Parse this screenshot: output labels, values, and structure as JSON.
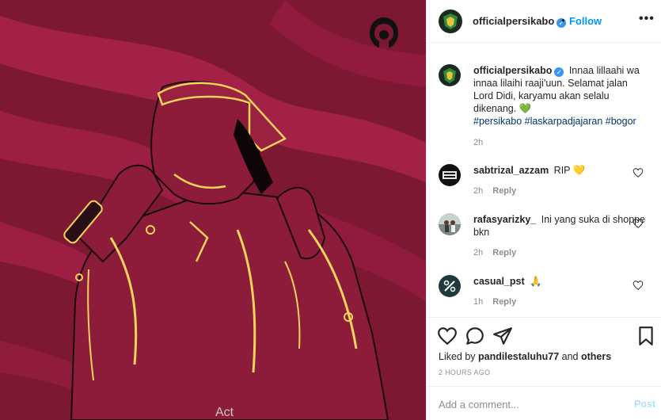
{
  "post": {
    "author": "officialpersikabo",
    "follow_label": "Follow",
    "dot": "•",
    "more_label": "•••"
  },
  "comments": [
    {
      "user": "officialpersikabo",
      "text": "Innaa lillaahi wa innaa lilaihi raaji'uun. Selamat jalan Lord Didi, karyamu akan selalu dikenang. 💚",
      "tags": "#persikabo #laskarpadjajaran #bogor",
      "time": "2h"
    },
    {
      "user": "sabtrizal_azzam",
      "text": "RIP 💛",
      "time": "2h",
      "reply": "Reply"
    },
    {
      "user": "rafasyarizky_",
      "text": "Ini yang suka di shoppe bkn",
      "time": "2h",
      "reply": "Reply"
    },
    {
      "user": "casual_pst",
      "text": "🙏",
      "time": "1h",
      "reply": "Reply"
    }
  ],
  "likes": {
    "prefix": "Liked by",
    "user": "pandilestaluhu77",
    "joiner": "and",
    "others": "others"
  },
  "time_ago": "2 HOURS AGO",
  "add_comment": {
    "placeholder": "Add a comment...",
    "post_label": "Post"
  },
  "watermark": "Act",
  "icons": [
    "like-icon",
    "comment-icon",
    "share-icon",
    "save-icon",
    "verified-icon",
    "more-icon"
  ],
  "colors": {
    "accent": "#0095f6",
    "artwork_bg": "#7d1833",
    "artwork_line": "#f2d35c",
    "verified": "#3897f0"
  }
}
